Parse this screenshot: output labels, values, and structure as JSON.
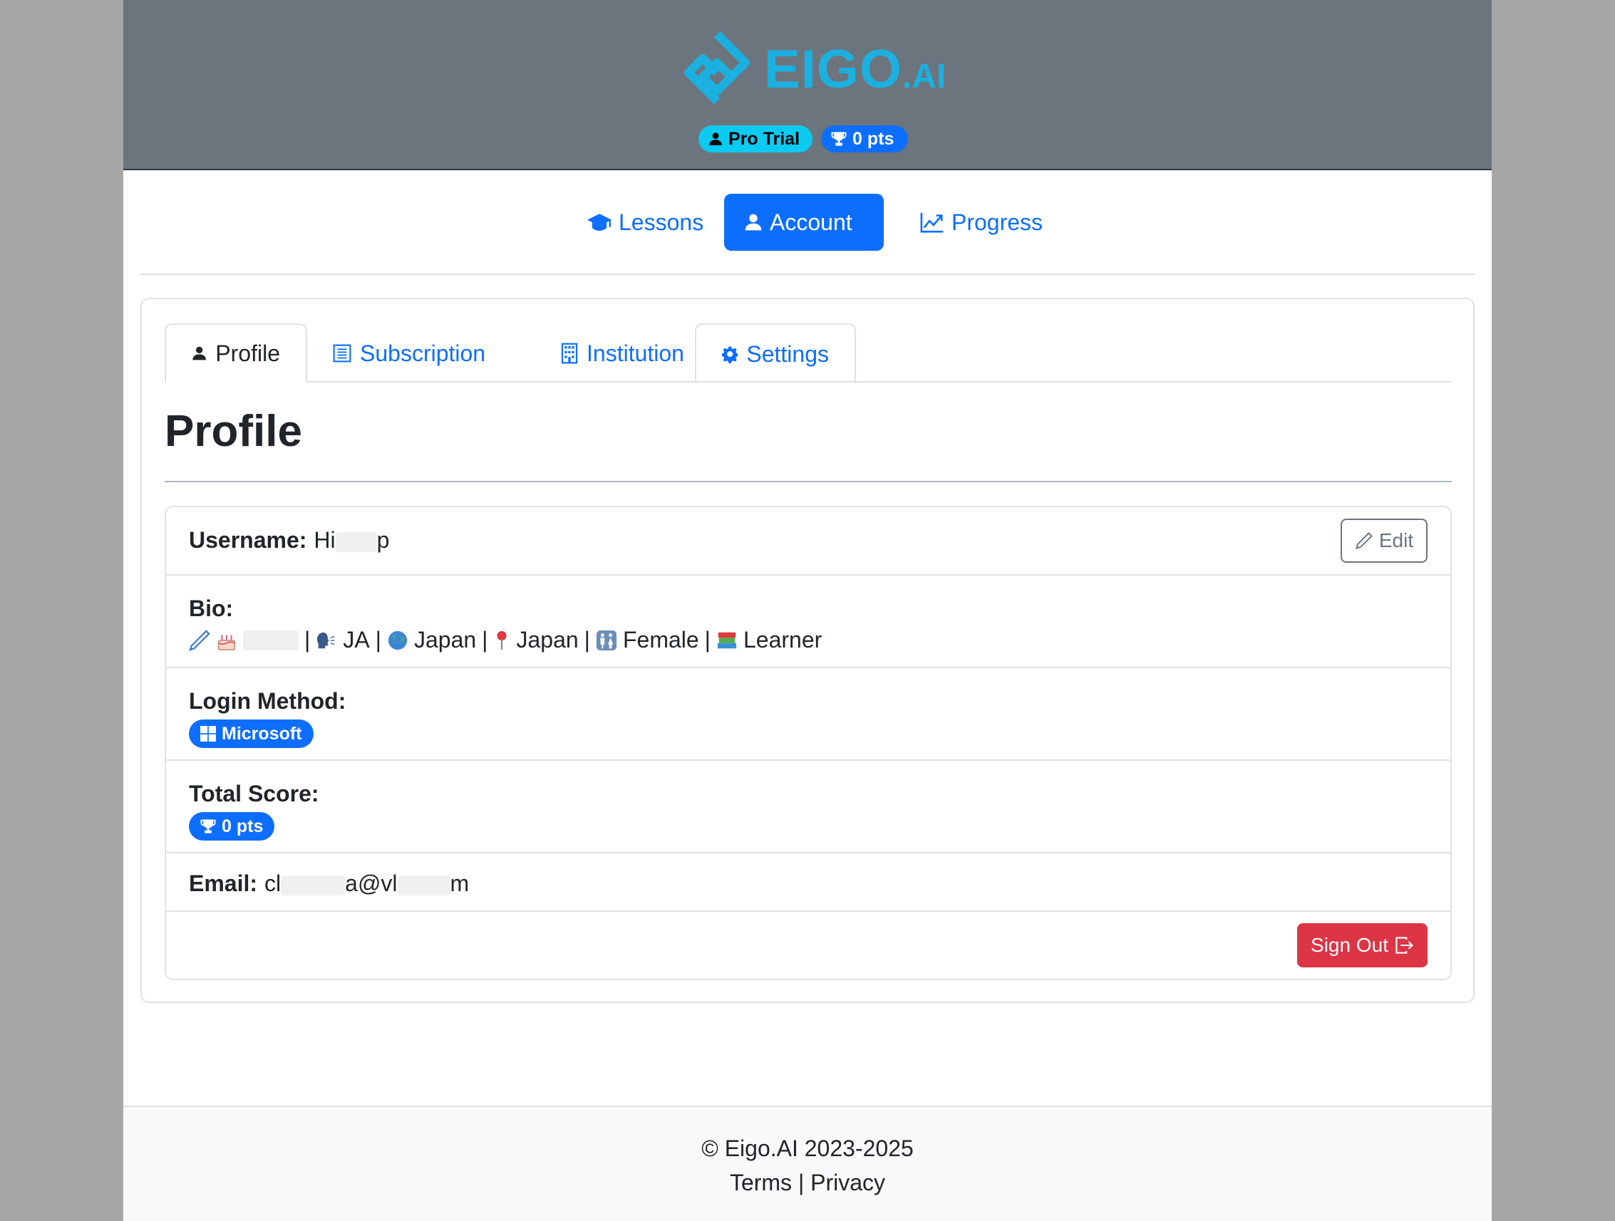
{
  "brand": {
    "logo_text": "EIGO",
    "logo_suffix": ".AI",
    "color": "#1bb0e0"
  },
  "header": {
    "plan_badge": "Pro Trial",
    "points_badge": "0 pts"
  },
  "nav": {
    "items": [
      {
        "label": "Lessons",
        "icon": "graduation-cap-icon"
      },
      {
        "label": "Account",
        "icon": "person-icon",
        "active": true
      },
      {
        "label": "Progress",
        "icon": "chart-line-icon"
      }
    ]
  },
  "tabs": [
    {
      "label": "Profile",
      "icon": "person-icon",
      "active": true
    },
    {
      "label": "Subscription",
      "icon": "document-list-icon"
    },
    {
      "label": "Institution",
      "icon": "building-icon"
    },
    {
      "label": "Settings",
      "icon": "gear-icon"
    }
  ],
  "profile": {
    "title": "Profile",
    "username_label": "Username:",
    "username_start": "Hi",
    "username_end": "p",
    "edit_label": "Edit",
    "bio_label": "Bio:",
    "bio": {
      "sep": "|",
      "lang": "JA",
      "country": "Japan",
      "location": "Japan",
      "gender": "Female",
      "role": "Learner"
    },
    "login_label": "Login Method:",
    "login_method": "Microsoft",
    "score_label": "Total Score:",
    "score_value": "0 pts",
    "email_label": "Email:",
    "email_parts": [
      "cl",
      "a@vl",
      "m"
    ],
    "signout_label": "Sign Out"
  },
  "colors": {
    "primary": "#0d6efd",
    "info": "#0dcaf0",
    "danger": "#dc3545",
    "header_bg": "#6c757d"
  },
  "footer": {
    "copyright": "© Eigo.AI 2023-2025",
    "terms": "Terms",
    "separator": "|",
    "privacy": "Privacy"
  }
}
